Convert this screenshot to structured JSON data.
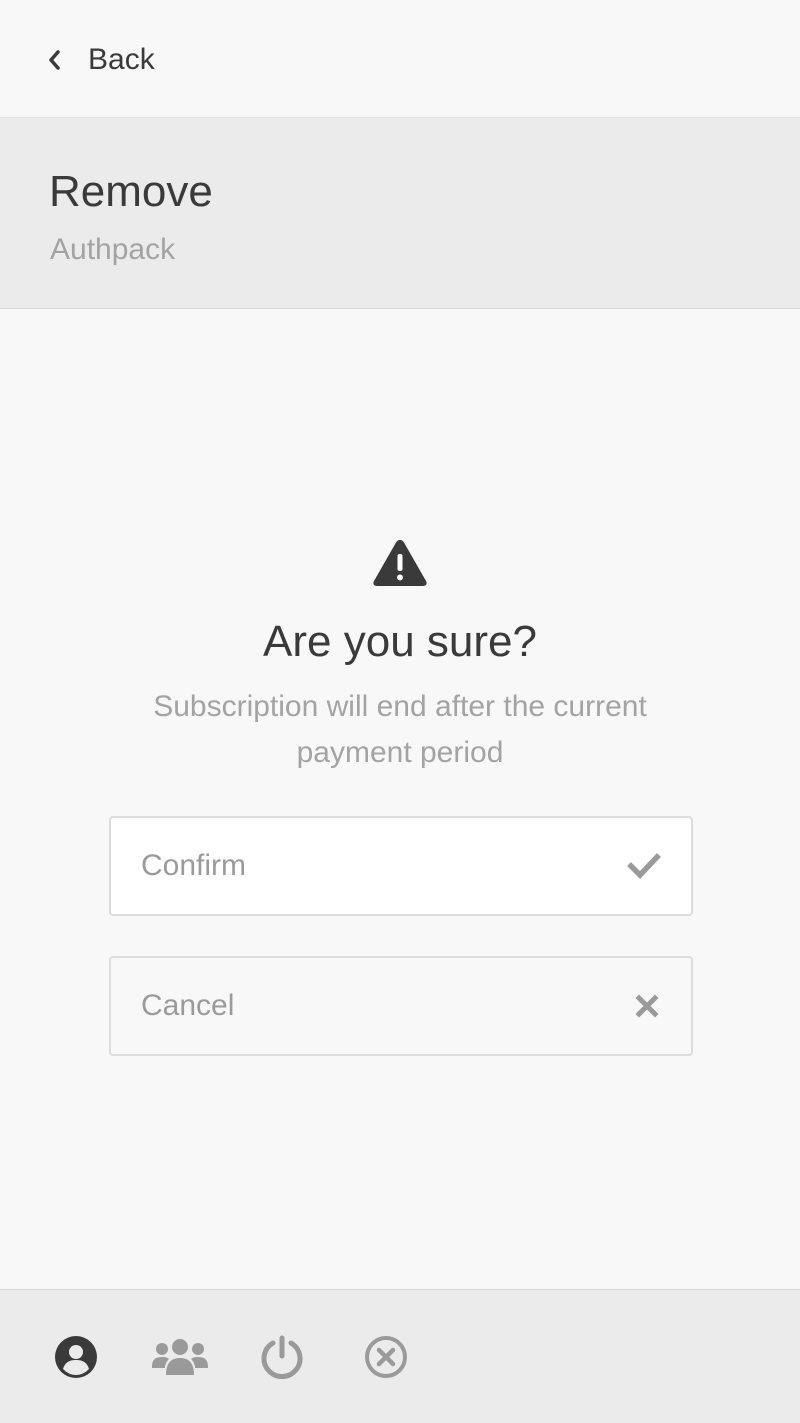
{
  "nav": {
    "back_label": "Back"
  },
  "header": {
    "title": "Remove",
    "subtitle": "Authpack"
  },
  "dialog": {
    "icon": "warning-triangle-icon",
    "title": "Are you sure?",
    "message": "Subscription will end after the current payment period",
    "confirm": {
      "label": "Confirm",
      "icon": "check-icon"
    },
    "cancel": {
      "label": "Cancel",
      "icon": "close-icon"
    }
  },
  "tabbar": {
    "tabs": [
      {
        "icon": "user-circle-icon",
        "active": true
      },
      {
        "icon": "users-icon",
        "active": false
      },
      {
        "icon": "power-icon",
        "active": false
      },
      {
        "icon": "close-circle-icon",
        "active": false
      }
    ]
  },
  "colors": {
    "background": "#f8f8f8",
    "header_background": "#ebebeb",
    "text_primary": "#3a3a3a",
    "text_secondary": "#a3a3a3",
    "icon_inactive": "#9a9a9a"
  }
}
